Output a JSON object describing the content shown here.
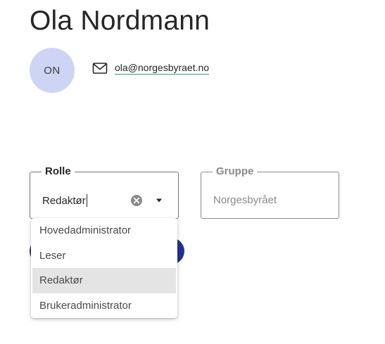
{
  "profile": {
    "name": "Ola Nordmann",
    "initials": "ON",
    "email": "ola@norgesbyraet.no"
  },
  "form": {
    "role_field": {
      "label": "Rolle",
      "value": "Redaktør"
    },
    "group_field": {
      "label": "Gruppe",
      "value": "Norgesbyrået"
    }
  },
  "role_menu": {
    "items": [
      {
        "label": "Hovedadministrator",
        "selected": false
      },
      {
        "label": "Leser",
        "selected": false
      },
      {
        "label": "Redaktør",
        "selected": true
      },
      {
        "label": "Brukeradministrator",
        "selected": false
      }
    ]
  },
  "icons": {
    "email": "mail-icon",
    "clear": "clear-circle-icon",
    "dropdown": "caret-down-icon"
  },
  "colors": {
    "avatar_bg": "#cdd4f4",
    "link_underline": "#2e9e7a",
    "primary_button": "#23328f",
    "menu_selected_bg": "#e4e4e4"
  }
}
